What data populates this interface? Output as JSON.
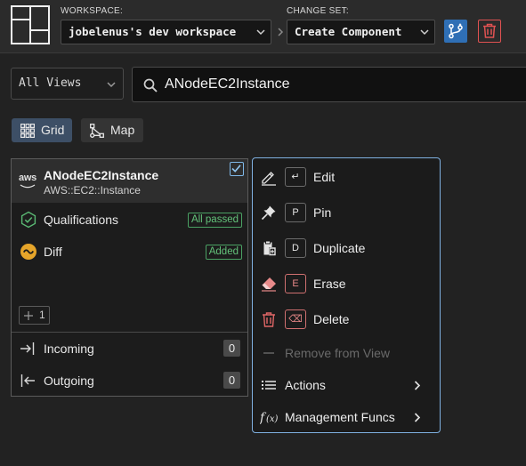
{
  "header": {
    "workspace_label": "WORKSPACE:",
    "workspace_value": "jobelenus's dev workspace",
    "changeset_label": "CHANGE SET:",
    "changeset_value": "Create Component",
    "colors": {
      "accent": "#2f6fb5",
      "danger": "#e05252"
    }
  },
  "filters": {
    "views_value": "All Views",
    "search_value": "ANodeEC2Instance",
    "search_placeholder": ""
  },
  "view_toggle": {
    "grid_label": "Grid",
    "map_label": "Map",
    "active": "Grid"
  },
  "component": {
    "provider_icon_text": "aws",
    "title": "ANodeEC2Instance",
    "subtitle": "AWS::EC2::Instance",
    "selected": true,
    "qualifications_label": "Qualifications",
    "qualifications_badge": "All passed",
    "diff_label": "Diff",
    "diff_badge": "Added",
    "plus_count": "1",
    "incoming_label": "Incoming",
    "incoming_count": "0",
    "outgoing_label": "Outgoing",
    "outgoing_count": "0"
  },
  "context_menu": {
    "items": [
      {
        "label": "Edit",
        "key": "↵",
        "icon": "pencil-icon",
        "enabled": true
      },
      {
        "label": "Pin",
        "key": "P",
        "icon": "pin-icon",
        "enabled": true
      },
      {
        "label": "Duplicate",
        "key": "D",
        "icon": "clipboard-copy-icon",
        "enabled": true
      },
      {
        "label": "Erase",
        "key": "E",
        "icon": "eraser-icon",
        "enabled": true
      },
      {
        "label": "Delete",
        "key": "⌫",
        "icon": "trash-icon",
        "enabled": true
      },
      {
        "label": "Remove from View",
        "icon": "minus-icon",
        "enabled": false
      },
      {
        "label": "Actions",
        "icon": "list-icon",
        "enabled": true,
        "submenu": true
      },
      {
        "label": "Management Funcs",
        "icon": "function-icon",
        "enabled": true,
        "submenu": true
      }
    ]
  }
}
